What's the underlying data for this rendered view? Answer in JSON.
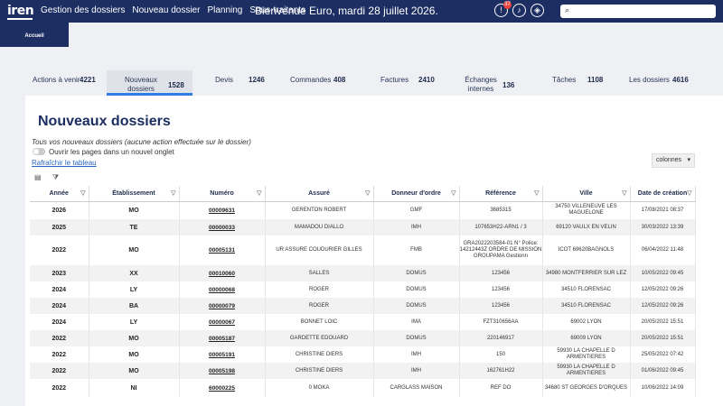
{
  "topbar": {
    "logo": "iren",
    "nav": [
      "Gestion des dossiers",
      "Nouveau dossier",
      "Planning",
      "Sous-traitants"
    ],
    "welcome": "Bienvenue Euro, mardi 28 juillet 2026.",
    "notif_count": "37",
    "search_placeholder": ""
  },
  "accueil": "Accueil",
  "tabs": [
    {
      "label": "Actions à venir",
      "count": "4221"
    },
    {
      "label": "Nouveaux dossiers",
      "count": "1528"
    },
    {
      "label": "Devis",
      "count": "1246"
    },
    {
      "label": "Commandes",
      "count": "408"
    },
    {
      "label": "Factures",
      "count": "2410"
    },
    {
      "label": "Échanges internes",
      "count": "136"
    },
    {
      "label": "Tâches",
      "count": "1108"
    },
    {
      "label": "Les dossiers",
      "count": "4616"
    }
  ],
  "main": {
    "title": "Nouveaux dossiers",
    "subtitle": "Tous vos nouveaux dossiers (aucune action effectuée sur le dossier)",
    "toggle_label": "Ouvrir les pages dans un nouvel onglet",
    "refresh": "Rafraîchir le tableau",
    "colonnes": "colonnes"
  },
  "table": {
    "headers": [
      "Année",
      "Établissement",
      "Numéro",
      "Assuré",
      "Donneur d'ordre",
      "Référence",
      "Ville",
      "Date de création"
    ],
    "rows": [
      [
        "2026",
        "MO",
        "00009631",
        "GERENTON ROBERT",
        "GMF",
        "3685315",
        "34750 VILLENEUVE LES MAGUELONE",
        "17/08/2021 08:37"
      ],
      [
        "2025",
        "TE",
        "00000033",
        "MAMADOU DIALLO",
        "IMH",
        "107653H22-ARN1 / 3",
        "69120 VAULX EN VELIN",
        "30/03/2022 13:39"
      ],
      [
        "2022",
        "MO",
        "00005131",
        "UR ASSURE COUDURIER GILLES",
        "FMB",
        "GRA2022203584-01 N° Police: 14212443Z ORDRE DE MISSION GROUPAMA Gestionn",
        "ICOT 69620BAGNOLS",
        "06/04/2022 11:48"
      ],
      [
        "2023",
        "XX",
        "00010060",
        "SALLES",
        "DOMUS",
        "123456",
        "34980 MONTFERRIER SUR LEZ",
        "10/05/2022 09:45"
      ],
      [
        "2024",
        "LY",
        "00000068",
        "ROGER",
        "DOMUS",
        "123456",
        "34510 FLORENSAC",
        "12/05/2022 09:26"
      ],
      [
        "2024",
        "BA",
        "00000079",
        "ROGER",
        "DOMUS",
        "123456",
        "34510 FLORENSAC",
        "12/05/2022 09:26"
      ],
      [
        "2024",
        "LY",
        "00000067",
        "BONNET LOIC",
        "IMA",
        "FZT310656AA",
        "69002 LYON",
        "20/05/2022 15:51"
      ],
      [
        "2022",
        "MO",
        "00005187",
        "GARDETTE EDOUARD",
        "DOMUS",
        "220146917",
        "69009 LYON",
        "20/05/2022 15:51"
      ],
      [
        "2022",
        "MO",
        "00005191",
        "CHRISTINE DIERS",
        "IMH",
        "150",
        "59930 LA CHAPELLE D ARMENTIERES",
        "25/05/2022 07:42"
      ],
      [
        "2022",
        "MO",
        "00005198",
        "CHRISTINE DIERS",
        "IMH",
        "162761H22",
        "59930 LA CHAPELLE D ARMENTIERES",
        "01/06/2022 09:45"
      ],
      [
        "2022",
        "NI",
        "60000225",
        "0 MOKA",
        "CARGLASS MAISON",
        "REF DO",
        "34680 ST GEORGES D'ORQUES",
        "10/06/2022 14:09"
      ]
    ]
  }
}
